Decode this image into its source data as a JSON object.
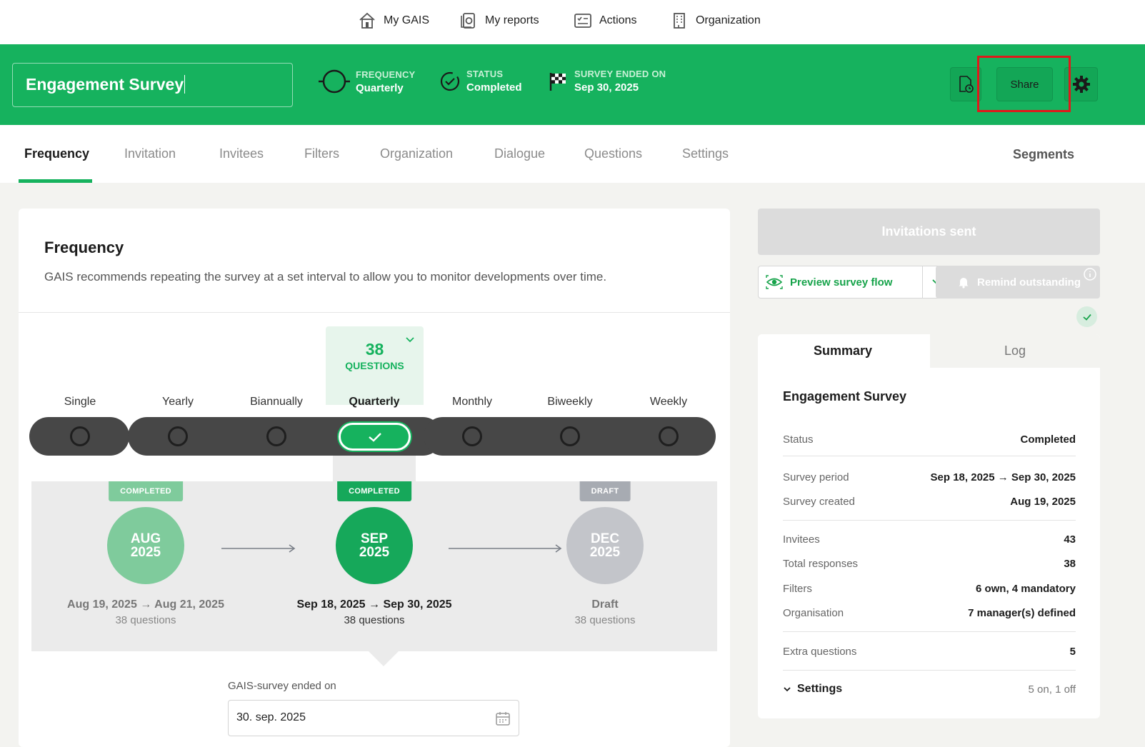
{
  "topnav": {
    "items": [
      {
        "label": "My GAIS",
        "icon": "home-icon"
      },
      {
        "label": "My reports",
        "icon": "reports-icon"
      },
      {
        "label": "Actions",
        "icon": "actions-icon"
      },
      {
        "label": "Organization",
        "icon": "building-icon"
      }
    ]
  },
  "header": {
    "survey_title": "Engagement Survey",
    "frequency_label": "FREQUENCY",
    "frequency_value": "Quarterly",
    "status_label": "STATUS",
    "status_value": "Completed",
    "ended_label": "SURVEY ENDED ON",
    "ended_value": "Sep 30, 2025",
    "share_label": "Share",
    "brand_color": "#16b25e"
  },
  "tabs": {
    "items": [
      "Frequency",
      "Invitation",
      "Invitees",
      "Filters",
      "Organization",
      "Dialogue",
      "Questions",
      "Settings"
    ],
    "active": "Frequency",
    "segments": "Segments"
  },
  "frequency": {
    "title": "Frequency",
    "description": "GAIS recommends repeating the survey at a set interval to allow you to monitor developments over time.",
    "question_count": "38",
    "question_label": "QUESTIONS",
    "options": [
      "Single",
      "Yearly",
      "Biannually",
      "Quarterly",
      "Monthly",
      "Biweekly",
      "Weekly"
    ],
    "selected": "Quarterly",
    "timeline": [
      {
        "badge": "COMPLETED",
        "month": "AUG",
        "year": "2025",
        "period": "Aug 19, 2025 → Aug 21, 2025",
        "questions": "38 questions",
        "state": "past"
      },
      {
        "badge": "COMPLETED",
        "month": "SEP",
        "year": "2025",
        "period": "Sep 18, 2025 → Sep 30, 2025",
        "questions": "38 questions",
        "state": "current"
      },
      {
        "badge": "DRAFT",
        "month": "DEC",
        "year": "2025",
        "period": "Draft",
        "questions": "38 questions",
        "state": "draft"
      }
    ],
    "ended_field_label": "GAIS-survey ended on",
    "ended_field_value": "30. sep. 2025"
  },
  "sidebar": {
    "invitations_sent": "Invitations sent",
    "preview_label": "Preview survey flow",
    "remind_label": "Remind outstanding",
    "summary_tab": "Summary",
    "log_tab": "Log",
    "summary_title": "Engagement Survey",
    "rows": [
      {
        "key": "Status",
        "value": "Completed"
      },
      {
        "key": "Survey period",
        "value": "Sep 18, 2025 → Sep 30, 2025"
      },
      {
        "key": "Survey created",
        "value": "Aug 19, 2025"
      },
      {
        "key": "Invitees",
        "value": "43"
      },
      {
        "key": "Total responses",
        "value": "38"
      },
      {
        "key": "Filters",
        "value": "6 own, 4 mandatory"
      },
      {
        "key": "Organisation",
        "value": "7 manager(s) defined"
      },
      {
        "key": "Extra questions",
        "value": "5"
      }
    ],
    "settings_label": "Settings",
    "settings_value": "5 on, 1 off"
  }
}
